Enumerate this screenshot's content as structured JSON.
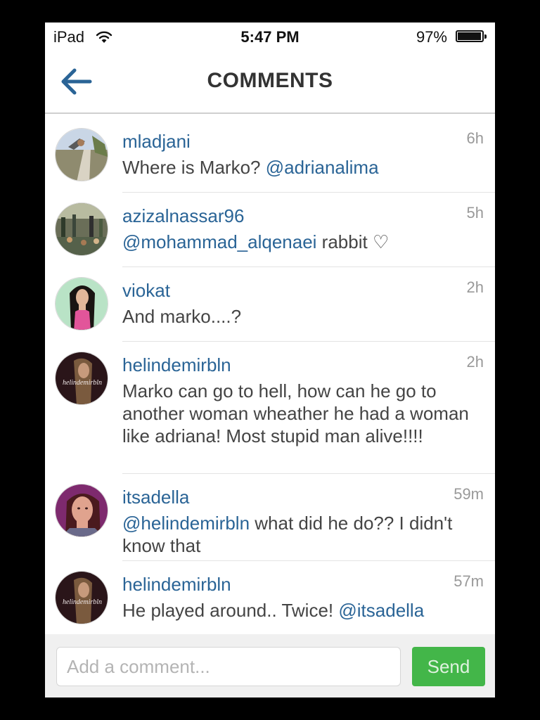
{
  "status_bar": {
    "carrier": "iPad",
    "wifi_icon": "wifi-icon",
    "time": "5:47 PM",
    "battery_percent": "97%",
    "battery_level": 0.97
  },
  "nav": {
    "back_icon": "arrow-left-icon",
    "title": "COMMENTS"
  },
  "comments": [
    {
      "username": "mladjani",
      "age": "6h",
      "segments": [
        {
          "text": "Where is Marko? ",
          "mention": false
        },
        {
          "text": "@adrianalima",
          "mention": true
        }
      ]
    },
    {
      "username": "azizalnassar96",
      "age": "5h",
      "segments": [
        {
          "text": "@mohammad_alqenaei",
          "mention": true
        },
        {
          "text": " rabbit ♡",
          "mention": false
        }
      ]
    },
    {
      "username": "viokat",
      "age": "2h",
      "segments": [
        {
          "text": "And marko....?",
          "mention": false
        }
      ]
    },
    {
      "username": "helindemirbln",
      "age": "2h",
      "segments": [
        {
          "text": "Marko can go to hell, how can he go to another woman wheather he had a woman like adriana! Most stupid man alive!!!!",
          "mention": false
        }
      ]
    },
    {
      "username": "itsadella",
      "age": "59m",
      "segments": [
        {
          "text": "@helindemirbln",
          "mention": true
        },
        {
          "text": " what did he do?? I didn't know that",
          "mention": false
        }
      ]
    },
    {
      "username": "helindemirbln",
      "age": "57m",
      "segments": [
        {
          "text": "He played around.. Twice! ",
          "mention": false
        },
        {
          "text": "@itsadella",
          "mention": true
        }
      ]
    }
  ],
  "composer": {
    "placeholder": "Add a comment...",
    "value": "",
    "send_label": "Send"
  },
  "colors": {
    "link": "#2a6496",
    "send_button": "#43b649",
    "timestamp": "#999999"
  }
}
